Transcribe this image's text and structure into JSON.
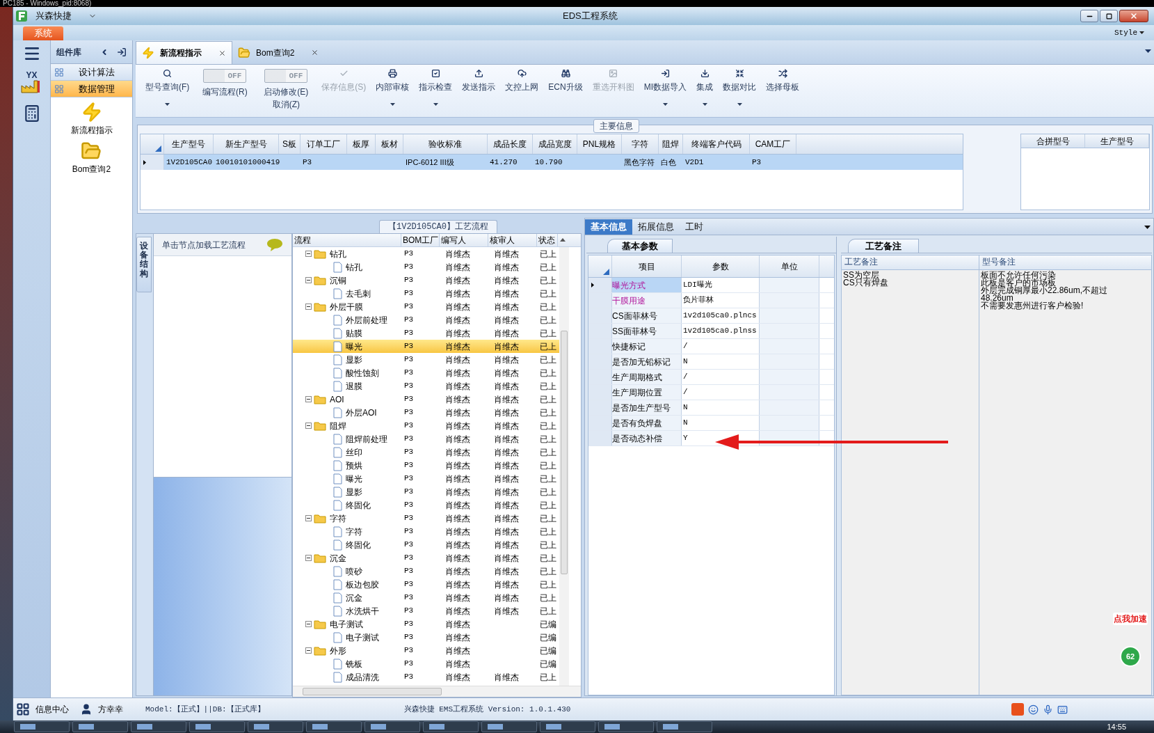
{
  "background_window": {
    "title": "PC185 - Windows_pid:8068)"
  },
  "window": {
    "app_name": "兴森快捷",
    "title": "EDS工程系统"
  },
  "menu": {
    "items": [
      {
        "label": "系统",
        "selected": true
      }
    ],
    "style": "Style"
  },
  "left_rail": {
    "logo_text": "YX"
  },
  "component_panel": {
    "title": "组件库",
    "items": [
      {
        "label": "设计算法",
        "selected": false
      },
      {
        "label": "数据管理",
        "selected": true
      }
    ],
    "shortcuts": [
      {
        "label": "新流程指示",
        "kind": "flow"
      },
      {
        "label": "Bom查询2",
        "kind": "query"
      }
    ]
  },
  "tabs": [
    {
      "label": "新流程指示",
      "kind": "flow",
      "selected": true
    },
    {
      "label": "Bom查询2",
      "kind": "query",
      "selected": false
    }
  ],
  "ribbon": [
    {
      "kind": "button",
      "label": "型号查询(F)",
      "disabled": false,
      "dropdown": true
    },
    {
      "kind": "toggle",
      "switch_text": "OFF",
      "on": false,
      "label": "编写流程(R)"
    },
    {
      "kind": "toggle",
      "switch_text": "OFF",
      "on": false,
      "label": "启动修改(E)",
      "sublabel": "取消(Z)"
    },
    {
      "kind": "button",
      "label": "保存信息(S)",
      "disabled": true,
      "dropdown": false
    },
    {
      "kind": "button",
      "label": "内部审核",
      "disabled": false,
      "dropdown": true
    },
    {
      "kind": "button",
      "label": "指示检查",
      "disabled": false,
      "dropdown": true
    },
    {
      "kind": "button",
      "label": "发送指示",
      "disabled": false,
      "dropdown": false
    },
    {
      "kind": "button",
      "label": "文控上网",
      "disabled": false,
      "dropdown": false
    },
    {
      "kind": "button",
      "label": "ECN升级",
      "disabled": false,
      "dropdown": false
    },
    {
      "kind": "button",
      "label": "重选开料图",
      "disabled": true,
      "dropdown": false
    },
    {
      "kind": "button",
      "label": "MI数据导入",
      "disabled": false,
      "dropdown": true
    },
    {
      "kind": "button",
      "label": "集成",
      "disabled": false,
      "dropdown": true
    },
    {
      "kind": "button",
      "label": "数据对比",
      "disabled": false,
      "dropdown": true
    },
    {
      "kind": "button",
      "label": "选择母板",
      "disabled": false,
      "dropdown": false
    }
  ],
  "main_info": {
    "title": "主要信息",
    "columns": [
      "生产型号",
      "新生产型号",
      "S板",
      "订单工厂",
      "板厚",
      "板材",
      "验收标准",
      "成品长度",
      "成品宽度",
      "PNL规格",
      "字符",
      "阻焊",
      "终端客户代码",
      "CAM工厂"
    ],
    "rows": [
      {
        "selected": true,
        "cells": [
          "1V2D105CA0",
          "10010101000419",
          "",
          "P3",
          "",
          "",
          "IPC-6012 III级",
          "41.270",
          "10.790",
          "",
          "黑色字符",
          "白色",
          "V2D1",
          "P3"
        ]
      }
    ],
    "side_columns": [
      "合拼型号",
      "生产型号"
    ]
  },
  "structure_panel": {
    "vertical_tab": "设备结构",
    "hint": "单击节点加载工艺流程"
  },
  "process_tree": {
    "title": "【1V2D105CA0】工艺流程",
    "columns": [
      "流程",
      "BOM工厂",
      "编写人",
      "核审人",
      "状态"
    ],
    "nodes": [
      {
        "name": "钻孔",
        "factory": "P3",
        "writer": "肖维杰",
        "reviewer": "肖维杰",
        "status": "已上",
        "selected": false,
        "expanded": true,
        "children": [
          {
            "name": "钻孔",
            "factory": "P3",
            "writer": "肖维杰",
            "reviewer": "肖维杰",
            "status": "已上",
            "selected": false
          }
        ]
      },
      {
        "name": "沉铜",
        "factory": "P3",
        "writer": "肖维杰",
        "reviewer": "肖维杰",
        "status": "已上",
        "selected": false,
        "expanded": true,
        "children": [
          {
            "name": "去毛刺",
            "factory": "P3",
            "writer": "肖维杰",
            "reviewer": "肖维杰",
            "status": "已上",
            "selected": false
          }
        ]
      },
      {
        "name": "外层干膜",
        "factory": "P3",
        "writer": "肖维杰",
        "reviewer": "肖维杰",
        "status": "已上",
        "selected": false,
        "expanded": true,
        "children": [
          {
            "name": "外层前处理",
            "factory": "P3",
            "writer": "肖维杰",
            "reviewer": "肖维杰",
            "status": "已上",
            "selected": false
          },
          {
            "name": "贴膜",
            "factory": "P3",
            "writer": "肖维杰",
            "reviewer": "肖维杰",
            "status": "已上",
            "selected": false
          },
          {
            "name": "曝光",
            "factory": "P3",
            "writer": "肖维杰",
            "reviewer": "肖维杰",
            "status": "已上",
            "selected": true
          },
          {
            "name": "显影",
            "factory": "P3",
            "writer": "肖维杰",
            "reviewer": "肖维杰",
            "status": "已上",
            "selected": false
          },
          {
            "name": "酸性蚀刻",
            "factory": "P3",
            "writer": "肖维杰",
            "reviewer": "肖维杰",
            "status": "已上",
            "selected": false
          },
          {
            "name": "退膜",
            "factory": "P3",
            "writer": "肖维杰",
            "reviewer": "肖维杰",
            "status": "已上",
            "selected": false
          }
        ]
      },
      {
        "name": "AOI",
        "factory": "P3",
        "writer": "肖维杰",
        "reviewer": "肖维杰",
        "status": "已上",
        "selected": false,
        "expanded": true,
        "children": [
          {
            "name": "外层AOI",
            "factory": "P3",
            "writer": "肖维杰",
            "reviewer": "肖维杰",
            "status": "已上",
            "selected": false
          }
        ]
      },
      {
        "name": "阻焊",
        "factory": "P3",
        "writer": "肖维杰",
        "reviewer": "肖维杰",
        "status": "已上",
        "selected": false,
        "expanded": true,
        "children": [
          {
            "name": "阻焊前处理",
            "factory": "P3",
            "writer": "肖维杰",
            "reviewer": "肖维杰",
            "status": "已上",
            "selected": false
          },
          {
            "name": "丝印",
            "factory": "P3",
            "writer": "肖维杰",
            "reviewer": "肖维杰",
            "status": "已上",
            "selected": false
          },
          {
            "name": "预烘",
            "factory": "P3",
            "writer": "肖维杰",
            "reviewer": "肖维杰",
            "status": "已上",
            "selected": false
          },
          {
            "name": "曝光",
            "factory": "P3",
            "writer": "肖维杰",
            "reviewer": "肖维杰",
            "status": "已上",
            "selected": false
          },
          {
            "name": "显影",
            "factory": "P3",
            "writer": "肖维杰",
            "reviewer": "肖维杰",
            "status": "已上",
            "selected": false
          },
          {
            "name": "终固化",
            "factory": "P3",
            "writer": "肖维杰",
            "reviewer": "肖维杰",
            "status": "已上",
            "selected": false
          }
        ]
      },
      {
        "name": "字符",
        "factory": "P3",
        "writer": "肖维杰",
        "reviewer": "肖维杰",
        "status": "已上",
        "selected": false,
        "expanded": true,
        "children": [
          {
            "name": "字符",
            "factory": "P3",
            "writer": "肖维杰",
            "reviewer": "肖维杰",
            "status": "已上",
            "selected": false
          },
          {
            "name": "终固化",
            "factory": "P3",
            "writer": "肖维杰",
            "reviewer": "肖维杰",
            "status": "已上",
            "selected": false
          }
        ]
      },
      {
        "name": "沉金",
        "factory": "P3",
        "writer": "肖维杰",
        "reviewer": "肖维杰",
        "status": "已上",
        "selected": false,
        "expanded": true,
        "children": [
          {
            "name": "喷砂",
            "factory": "P3",
            "writer": "肖维杰",
            "reviewer": "肖维杰",
            "status": "已上",
            "selected": false
          },
          {
            "name": "板边包胶",
            "factory": "P3",
            "writer": "肖维杰",
            "reviewer": "肖维杰",
            "status": "已上",
            "selected": false
          },
          {
            "name": "沉金",
            "factory": "P3",
            "writer": "肖维杰",
            "reviewer": "肖维杰",
            "status": "已上",
            "selected": false
          },
          {
            "name": "水洗烘干",
            "factory": "P3",
            "writer": "肖维杰",
            "reviewer": "肖维杰",
            "status": "已上",
            "selected": false
          }
        ]
      },
      {
        "name": "电子测试",
        "factory": "P3",
        "writer": "肖维杰",
        "status": "已编",
        "selected": false,
        "expanded": true,
        "children": [
          {
            "name": "电子测试",
            "factory": "P3",
            "writer": "肖维杰",
            "status": "已编",
            "selected": false
          }
        ]
      },
      {
        "name": "外形",
        "factory": "P3",
        "writer": "肖维杰",
        "status": "已编",
        "selected": false,
        "expanded": true,
        "children": [
          {
            "name": "铣板",
            "factory": "P3",
            "writer": "肖维杰",
            "status": "已编",
            "selected": false
          },
          {
            "name": "成品清洗",
            "factory": "P3",
            "writer": "肖维杰",
            "reviewer": "肖维杰",
            "status": "已上",
            "selected": false
          }
        ]
      }
    ]
  },
  "detail_tabs": [
    {
      "label": "基本信息",
      "selected": true
    },
    {
      "label": "拓展信息",
      "selected": false
    },
    {
      "label": "工时",
      "selected": false
    }
  ],
  "params": {
    "tab": "基本参数",
    "columns": [
      "项目",
      "参数",
      "单位"
    ],
    "rows": [
      {
        "item": "曝光方式",
        "value": "LDI曝光",
        "highlighted": true,
        "selected": true
      },
      {
        "item": "干膜用途",
        "value": "负片菲林",
        "highlighted": true,
        "selected": false
      },
      {
        "item": "CS面菲林号",
        "value": "1v2d105ca0.plncs",
        "highlighted": false,
        "selected": false
      },
      {
        "item": "SS面菲林号",
        "value": "1v2d105ca0.plnss",
        "highlighted": false,
        "selected": false
      },
      {
        "item": "快捷标记",
        "value": "/",
        "highlighted": false,
        "selected": false
      },
      {
        "item": "是否加无铅标记",
        "value": "N",
        "highlighted": false,
        "selected": false
      },
      {
        "item": "生产周期格式",
        "value": "/",
        "highlighted": false,
        "selected": false
      },
      {
        "item": "生产周期位置",
        "value": "/",
        "highlighted": false,
        "selected": false
      },
      {
        "item": "是否加生产型号",
        "value": "N",
        "highlighted": false,
        "selected": false
      },
      {
        "item": "是否有负焊盘",
        "value": "N",
        "highlighted": false,
        "selected": false
      },
      {
        "item": "是否动态补偿",
        "value": "Y",
        "highlighted": false,
        "selected": false
      }
    ]
  },
  "notes": {
    "tab": "工艺备注",
    "columns": [
      "工艺备注",
      "型号备注"
    ],
    "process_note": [
      "SS为空层",
      "CS只有焊盘"
    ],
    "model_note": [
      "板面不允许任何污染",
      "此板是客户的市场板",
      "外层完成铜厚最小22.86um,不超过",
      "48.26um",
      "不需要发惠州进行客户检验!"
    ]
  },
  "speed_widget": {
    "label": "点我加速",
    "value": "62"
  },
  "status_bar": {
    "info_center": "信息中心",
    "user": "方幸幸",
    "model": "Model:【正式】||DB:【正式库】",
    "version": "兴森快捷  EMS工程系统  Version: 1.0.1.430"
  },
  "taskbar": {
    "clock": "14:55"
  }
}
